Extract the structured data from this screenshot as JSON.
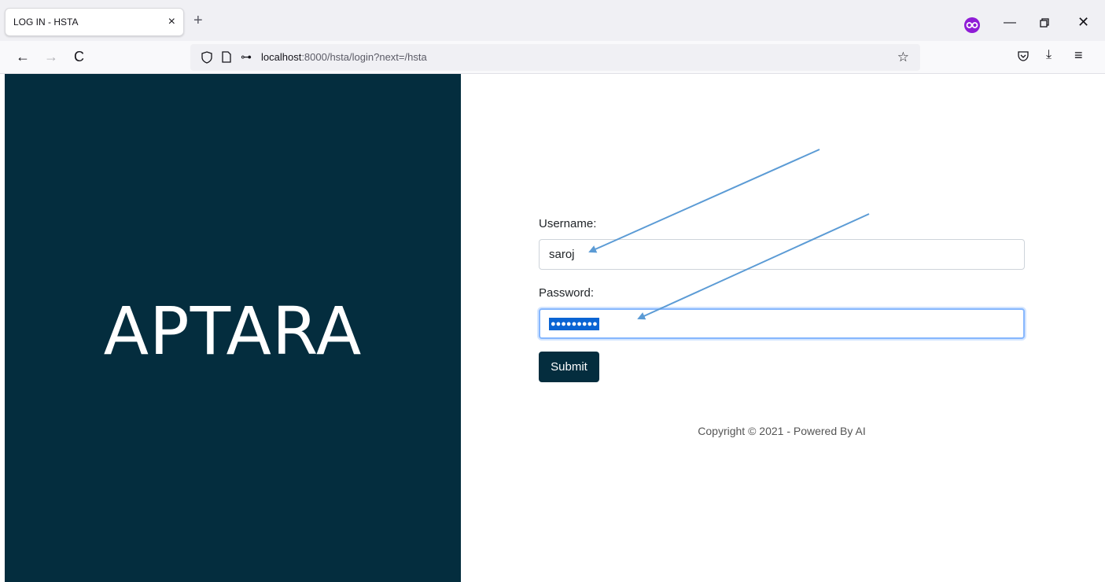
{
  "browser": {
    "tab_title": "LOG IN - HSTA",
    "tab_close": "×",
    "new_tab": "+",
    "url_host": "localhost",
    "url_rest": ":8000/hsta/login?next=/hsta",
    "win_min": "—",
    "win_close": "✕"
  },
  "icons": {
    "back": "←",
    "forward": "→",
    "reload": "C",
    "key": "⊶",
    "star": "☆",
    "download": "⤓",
    "menu": "≡"
  },
  "page": {
    "brand": "APTARA",
    "username_label": "Username:",
    "username_value": "saroj",
    "password_label": "Password:",
    "password_masked": "●●●●●●●●●",
    "submit_label": "Submit",
    "copyright": "Copyright © 2021 - Powered By AI"
  },
  "colors": {
    "brand_bg": "#042d3e",
    "annotation_arrow": "#5b9bd5",
    "selection": "#0a64d3"
  }
}
